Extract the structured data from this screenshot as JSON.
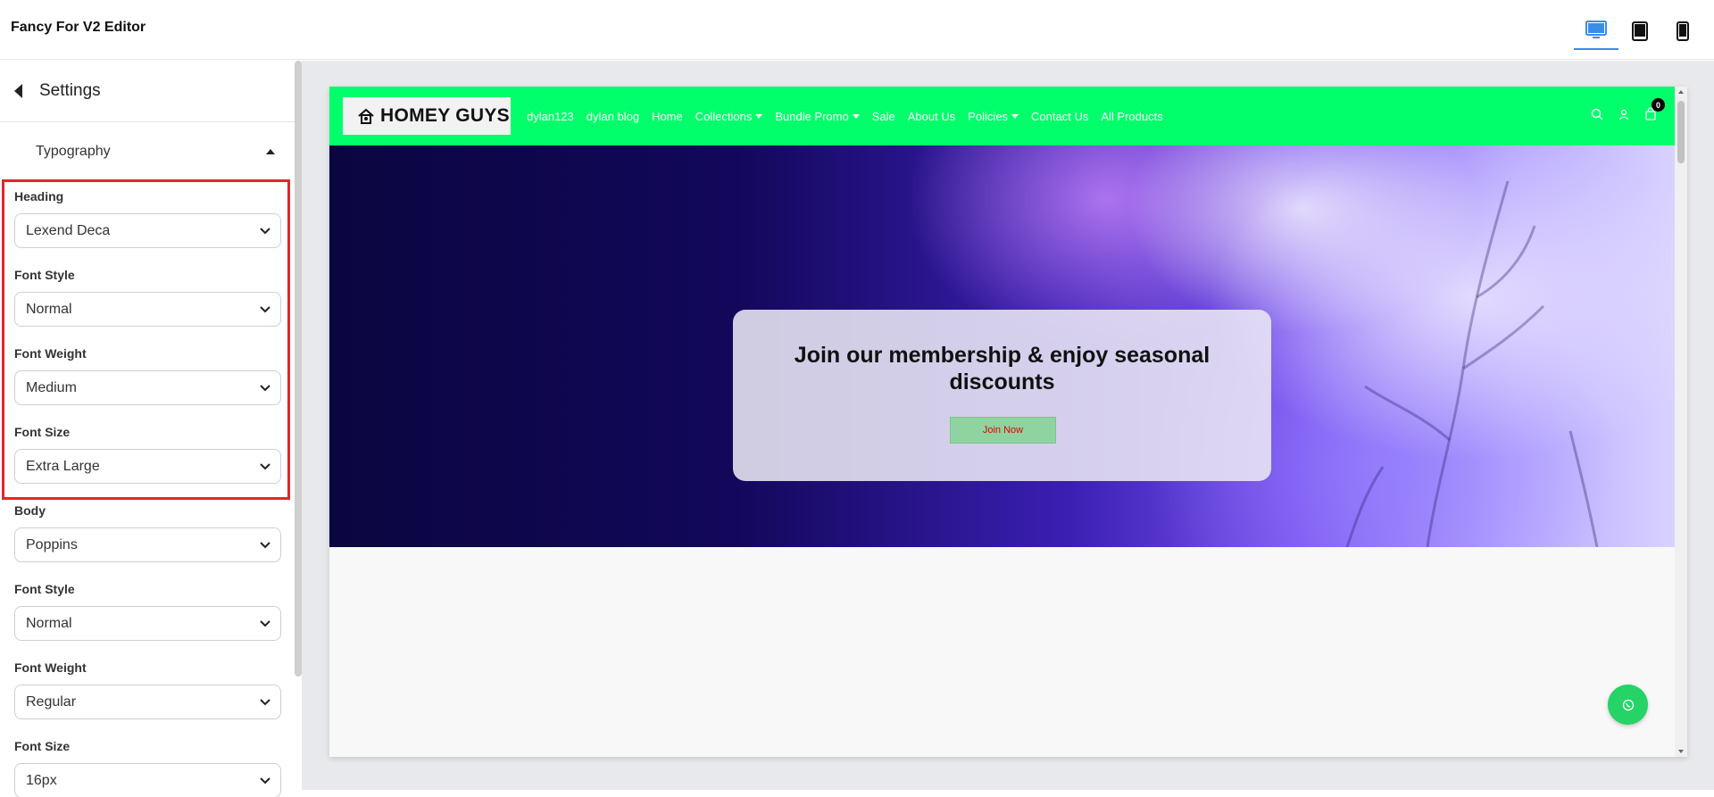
{
  "app": {
    "title": "Fancy For V2 Editor"
  },
  "devices": [
    {
      "name": "desktop",
      "icon": "desktop-icon",
      "active": true
    },
    {
      "name": "tablet",
      "icon": "tablet-icon",
      "active": false
    },
    {
      "name": "mobile",
      "icon": "mobile-icon",
      "active": false
    }
  ],
  "sidebar": {
    "title": "Settings",
    "section": "Typography",
    "heading_group": {
      "font_label": "Heading",
      "font_value": "Lexend Deca",
      "style_label": "Font Style",
      "style_value": "Normal",
      "weight_label": "Font Weight",
      "weight_value": "Medium",
      "size_label": "Font Size",
      "size_value": "Extra Large"
    },
    "body_group": {
      "font_label": "Body",
      "font_value": "Poppins",
      "style_label": "Font Style",
      "style_value": "Normal",
      "weight_label": "Font Weight",
      "weight_value": "Regular",
      "size_label": "Font Size",
      "size_value": "16px"
    }
  },
  "store": {
    "logo_text": "HOMEY GUYS",
    "nav": [
      {
        "label": "dylan123",
        "dropdown": false
      },
      {
        "label": "dylan blog",
        "dropdown": false
      },
      {
        "label": "Home",
        "dropdown": false
      },
      {
        "label": "Collections",
        "dropdown": true
      },
      {
        "label": "Bundle Promo",
        "dropdown": true
      },
      {
        "label": "Sale",
        "dropdown": false
      },
      {
        "label": "About Us",
        "dropdown": false
      },
      {
        "label": "Policies",
        "dropdown": true
      },
      {
        "label": "Contact Us",
        "dropdown": false
      },
      {
        "label": "All Products",
        "dropdown": false
      }
    ],
    "cart_count": "0",
    "hero": {
      "title": "Join our membership & enjoy seasonal discounts",
      "button": "Join Now"
    }
  },
  "colors": {
    "nav_bg": "#00ff6a",
    "highlight": "#e3262a",
    "join_button_bg": "#8fd3a0",
    "join_button_text": "#e00000",
    "whatsapp": "#25d366",
    "active_device": "#3a8ee6"
  }
}
